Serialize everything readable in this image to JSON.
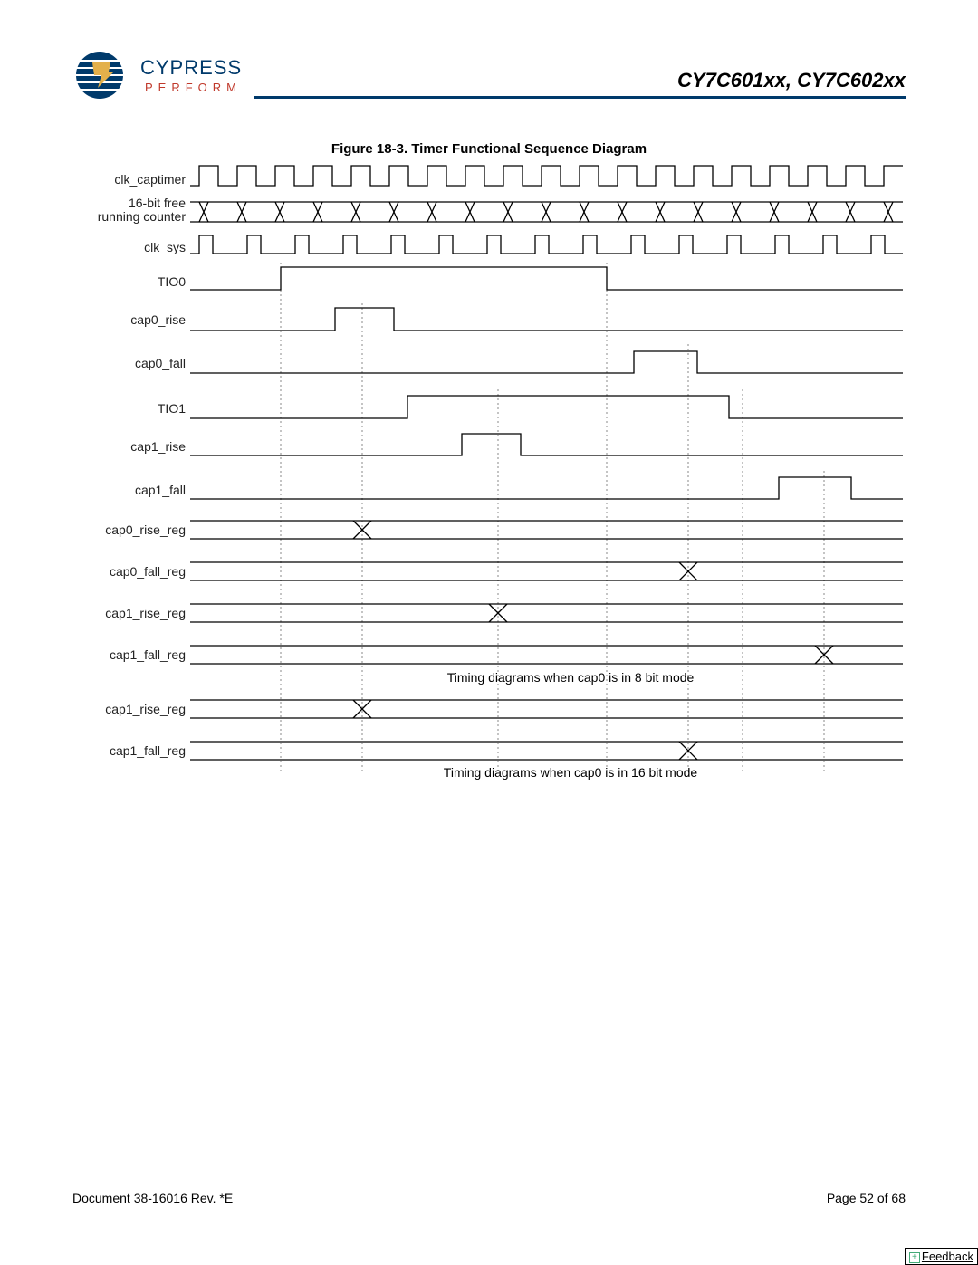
{
  "header": {
    "logo_name": "CYPRESS",
    "logo_tag": "PERFORM",
    "part_numbers": "CY7C601xx, CY7C602xx"
  },
  "figure": {
    "title": "Figure 18-3. Timer Functional Sequence Diagram",
    "annotation_8bit": "Timing diagrams when cap0 is in 8 bit mode",
    "annotation_16bit": "Timing diagrams when cap0 is in 16 bit mode"
  },
  "signals": [
    {
      "name": "clk_captimer",
      "label": "clk_captimer",
      "type": "clock"
    },
    {
      "name": "counter16",
      "label": "16-bit free\nrunning counter",
      "type": "bus"
    },
    {
      "name": "clk_sys",
      "label": "clk_sys",
      "type": "clock2"
    },
    {
      "name": "TIO0",
      "label": "TIO0",
      "type": "step"
    },
    {
      "name": "cap0_rise",
      "label": "cap0_rise",
      "type": "pulse"
    },
    {
      "name": "cap0_fall",
      "label": "cap0_fall",
      "type": "pulse"
    },
    {
      "name": "TIO1",
      "label": "TIO1",
      "type": "step"
    },
    {
      "name": "cap1_rise",
      "label": "cap1_rise",
      "type": "pulse"
    },
    {
      "name": "cap1_fall",
      "label": "cap1_fall",
      "type": "pulse"
    },
    {
      "name": "cap0_rise_reg",
      "label": "cap0_rise_reg",
      "type": "reg"
    },
    {
      "name": "cap0_fall_reg",
      "label": "cap0_fall_reg",
      "type": "reg"
    },
    {
      "name": "cap1_rise_reg",
      "label": "cap1_rise_reg",
      "type": "reg"
    },
    {
      "name": "cap1_fall_reg",
      "label": "cap1_fall_reg",
      "type": "reg"
    },
    {
      "name": "cap1_rise_reg16",
      "label": "cap1_rise_reg",
      "type": "reg"
    },
    {
      "name": "cap1_fall_reg16",
      "label": "cap1_fall_reg",
      "type": "reg"
    }
  ],
  "footer": {
    "doc_rev": "Document 38-16016 Rev. *E",
    "page": "Page 52 of 68",
    "feedback": "Feedback"
  }
}
